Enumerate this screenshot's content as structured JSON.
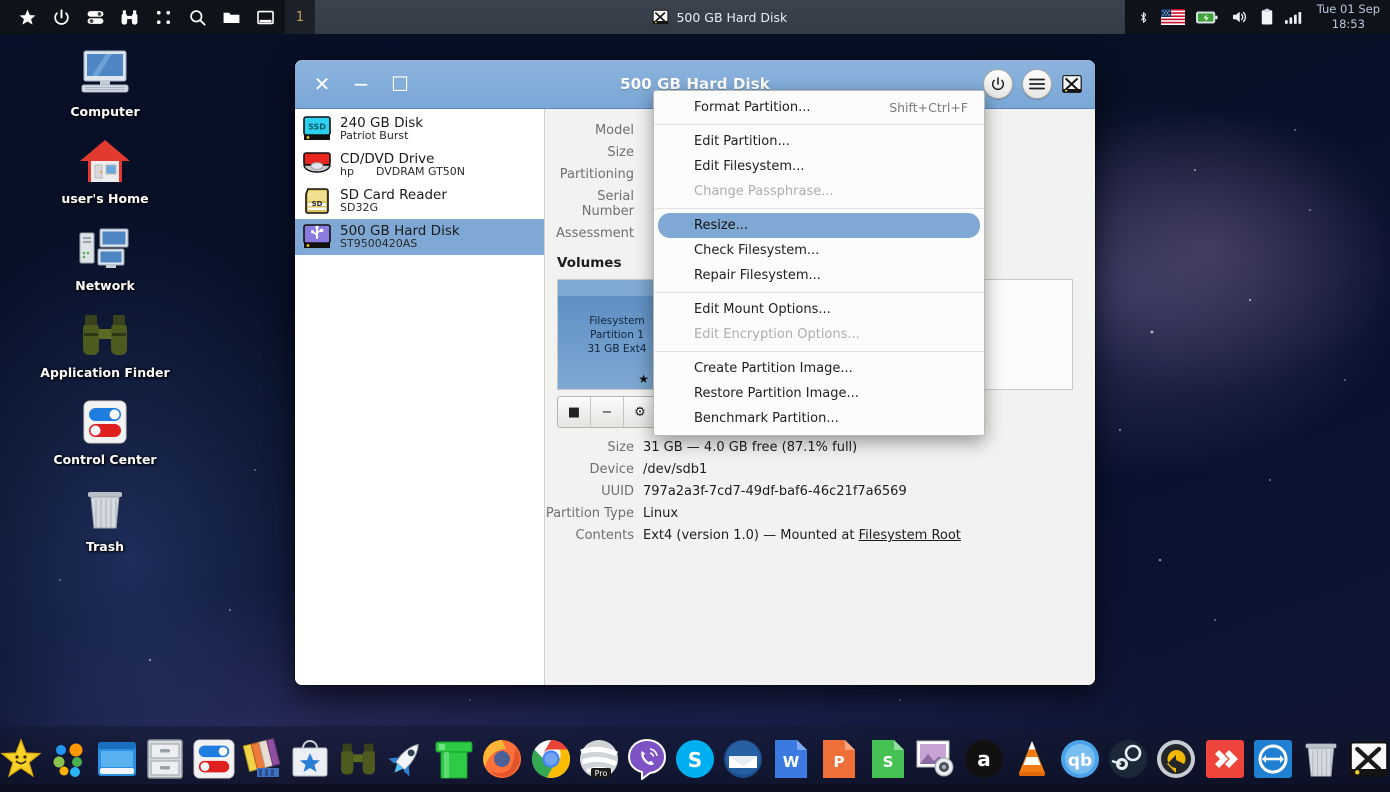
{
  "panel": {
    "launchers": [
      {
        "name": "whisker-menu-star-icon",
        "glyph": "star"
      },
      {
        "name": "power-icon",
        "glyph": "power"
      },
      {
        "name": "settings-toggles-icon",
        "glyph": "toggles"
      },
      {
        "name": "binoculars-finder-icon",
        "glyph": "binoculars"
      },
      {
        "name": "grid-apps-icon",
        "glyph": "dots"
      },
      {
        "name": "search-icon",
        "glyph": "search"
      },
      {
        "name": "file-manager-icon",
        "glyph": "folder"
      },
      {
        "name": "show-desktop-icon",
        "glyph": "window"
      }
    ],
    "workspace": "1",
    "task": {
      "label": "500 GB Hard Disk",
      "icon": "gnome-disks-icon"
    },
    "tray": [
      {
        "name": "bluetooth-icon"
      },
      {
        "name": "keyboard-layout-us-flag-icon"
      },
      {
        "name": "battery-icon"
      },
      {
        "name": "volume-icon"
      },
      {
        "name": "clipboard-icon"
      },
      {
        "name": "network-signal-icon"
      }
    ],
    "clock": {
      "date": "Tue 01 Sep",
      "time": "18:53"
    }
  },
  "desktop_icons": [
    {
      "label": "Computer",
      "icon": "computer-icon"
    },
    {
      "label": "user's Home",
      "icon": "home-icon"
    },
    {
      "label": "Network",
      "icon": "network-icon"
    },
    {
      "label": "Application Finder",
      "icon": "binoculars-icon"
    },
    {
      "label": "Control Center",
      "icon": "control-center-icon"
    },
    {
      "label": "Trash",
      "icon": "trash-icon"
    }
  ],
  "window": {
    "title": "500 GB Hard Disk",
    "controls": {
      "close": "✕",
      "minimize": "−",
      "maximize": "☐"
    },
    "header_buttons": [
      {
        "name": "power-off-button",
        "glyph": "power"
      },
      {
        "name": "hamburger-menu-button",
        "glyph": "menu"
      },
      {
        "name": "app-icon",
        "glyph": "disks"
      }
    ],
    "devices": [
      {
        "name": "240 GB Disk",
        "sub": "Patriot Burst",
        "sub2": "",
        "icon": "ssd-icon",
        "selected": false
      },
      {
        "name": "CD/DVD Drive",
        "sub": "hp",
        "sub2": "DVDRAM GT50N",
        "icon": "optical-drive-icon",
        "selected": false
      },
      {
        "name": "SD Card Reader",
        "sub": "SD32G",
        "sub2": "",
        "icon": "sd-card-icon",
        "selected": false
      },
      {
        "name": "500 GB Hard Disk",
        "sub": "ST9500420AS",
        "sub2": "",
        "icon": "usb-disk-icon",
        "selected": true
      }
    ],
    "drive_info": [
      {
        "key": "Model",
        "value": ""
      },
      {
        "key": "Size",
        "value": ""
      },
      {
        "key": "Partitioning",
        "value": ""
      },
      {
        "key": "Serial Number",
        "value": ""
      },
      {
        "key": "Assessment",
        "value": ""
      }
    ],
    "volumes_label": "Volumes",
    "partition": {
      "line1": "Filesystem",
      "line2": "Partition 1",
      "line3": "31 GB Ext4",
      "marks": "★ ▶"
    },
    "volume_toolbar": [
      {
        "name": "unmount-button",
        "glyph": "■"
      },
      {
        "name": "delete-partition-button",
        "glyph": "−"
      },
      {
        "name": "more-actions-button",
        "glyph": "⚙"
      }
    ],
    "partition_info": [
      {
        "key": "Size",
        "value": "31 GB — 4.0 GB free (87.1% full)",
        "link": ""
      },
      {
        "key": "Device",
        "value": "/dev/sdb1",
        "link": ""
      },
      {
        "key": "UUID",
        "value": "797a2a3f-7cd7-49df-baf6-46c21f7a6569",
        "link": ""
      },
      {
        "key": "Partition Type",
        "value": "Linux",
        "link": ""
      },
      {
        "key": "Contents",
        "value": "Ext4 (version 1.0) — Mounted at ",
        "link": "Filesystem Root"
      }
    ]
  },
  "context_menu": [
    {
      "label": "Format Partition...",
      "accel": "Shift+Ctrl+F",
      "disabled": false,
      "highlighted": false,
      "sep_after": true
    },
    {
      "label": "Edit Partition...",
      "accel": "",
      "disabled": false,
      "highlighted": false,
      "sep_after": false
    },
    {
      "label": "Edit Filesystem...",
      "accel": "",
      "disabled": false,
      "highlighted": false,
      "sep_after": false
    },
    {
      "label": "Change Passphrase...",
      "accel": "",
      "disabled": true,
      "highlighted": false,
      "sep_after": true
    },
    {
      "label": "Resize...",
      "accel": "",
      "disabled": false,
      "highlighted": true,
      "sep_after": false
    },
    {
      "label": "Check Filesystem...",
      "accel": "",
      "disabled": false,
      "highlighted": false,
      "sep_after": false
    },
    {
      "label": "Repair Filesystem...",
      "accel": "",
      "disabled": false,
      "highlighted": false,
      "sep_after": true
    },
    {
      "label": "Edit Mount Options...",
      "accel": "",
      "disabled": false,
      "highlighted": false,
      "sep_after": false
    },
    {
      "label": "Edit Encryption Options...",
      "accel": "",
      "disabled": true,
      "highlighted": false,
      "sep_after": true
    },
    {
      "label": "Create Partition Image...",
      "accel": "",
      "disabled": false,
      "highlighted": false,
      "sep_after": false
    },
    {
      "label": "Restore Partition Image...",
      "accel": "",
      "disabled": false,
      "highlighted": false,
      "sep_after": false
    },
    {
      "label": "Benchmark Partition...",
      "accel": "",
      "disabled": false,
      "highlighted": false,
      "sep_after": false
    }
  ],
  "dock": [
    {
      "name": "whisker-star-icon",
      "glyph": "star"
    },
    {
      "name": "app-grid-dots-icon",
      "glyph": "dots"
    },
    {
      "name": "window-manager-icon",
      "glyph": "bluewin"
    },
    {
      "name": "file-cabinet-icon",
      "glyph": "cabinet"
    },
    {
      "name": "control-center-icon",
      "glyph": "toggles"
    },
    {
      "name": "theme-config-icon",
      "glyph": "palette"
    },
    {
      "name": "software-store-icon",
      "glyph": "store"
    },
    {
      "name": "binoculars-icon",
      "glyph": "binoc"
    },
    {
      "name": "rocket-launcher-icon",
      "glyph": "rocket"
    },
    {
      "name": "pipe-icon",
      "glyph": "pipe"
    },
    {
      "name": "firefox-icon",
      "glyph": "firefox"
    },
    {
      "name": "chrome-icon",
      "glyph": "chrome"
    },
    {
      "name": "opera-pro-icon",
      "glyph": "opera"
    },
    {
      "name": "viber-icon",
      "glyph": "viber"
    },
    {
      "name": "skype-icon",
      "glyph": "skype"
    },
    {
      "name": "thunderbird-icon",
      "glyph": "thunderbird"
    },
    {
      "name": "writer-document-icon",
      "glyph": "wdoc"
    },
    {
      "name": "presentation-icon",
      "glyph": "pdoc"
    },
    {
      "name": "spreadsheet-icon",
      "glyph": "sdoc"
    },
    {
      "name": "image-viewer-icon",
      "glyph": "imgview"
    },
    {
      "name": "amazon-icon",
      "glyph": "amazon"
    },
    {
      "name": "vlc-icon",
      "glyph": "vlc"
    },
    {
      "name": "qbittorrent-icon",
      "glyph": "qb"
    },
    {
      "name": "steam-icon",
      "glyph": "steam"
    },
    {
      "name": "backup-restore-icon",
      "glyph": "undo"
    },
    {
      "name": "anydesk-icon",
      "glyph": "anydesk"
    },
    {
      "name": "teamviewer-icon",
      "glyph": "teamviewer"
    },
    {
      "name": "trash-icon",
      "glyph": "trash"
    },
    {
      "name": "gnome-disks-icon",
      "glyph": "disks"
    }
  ]
}
